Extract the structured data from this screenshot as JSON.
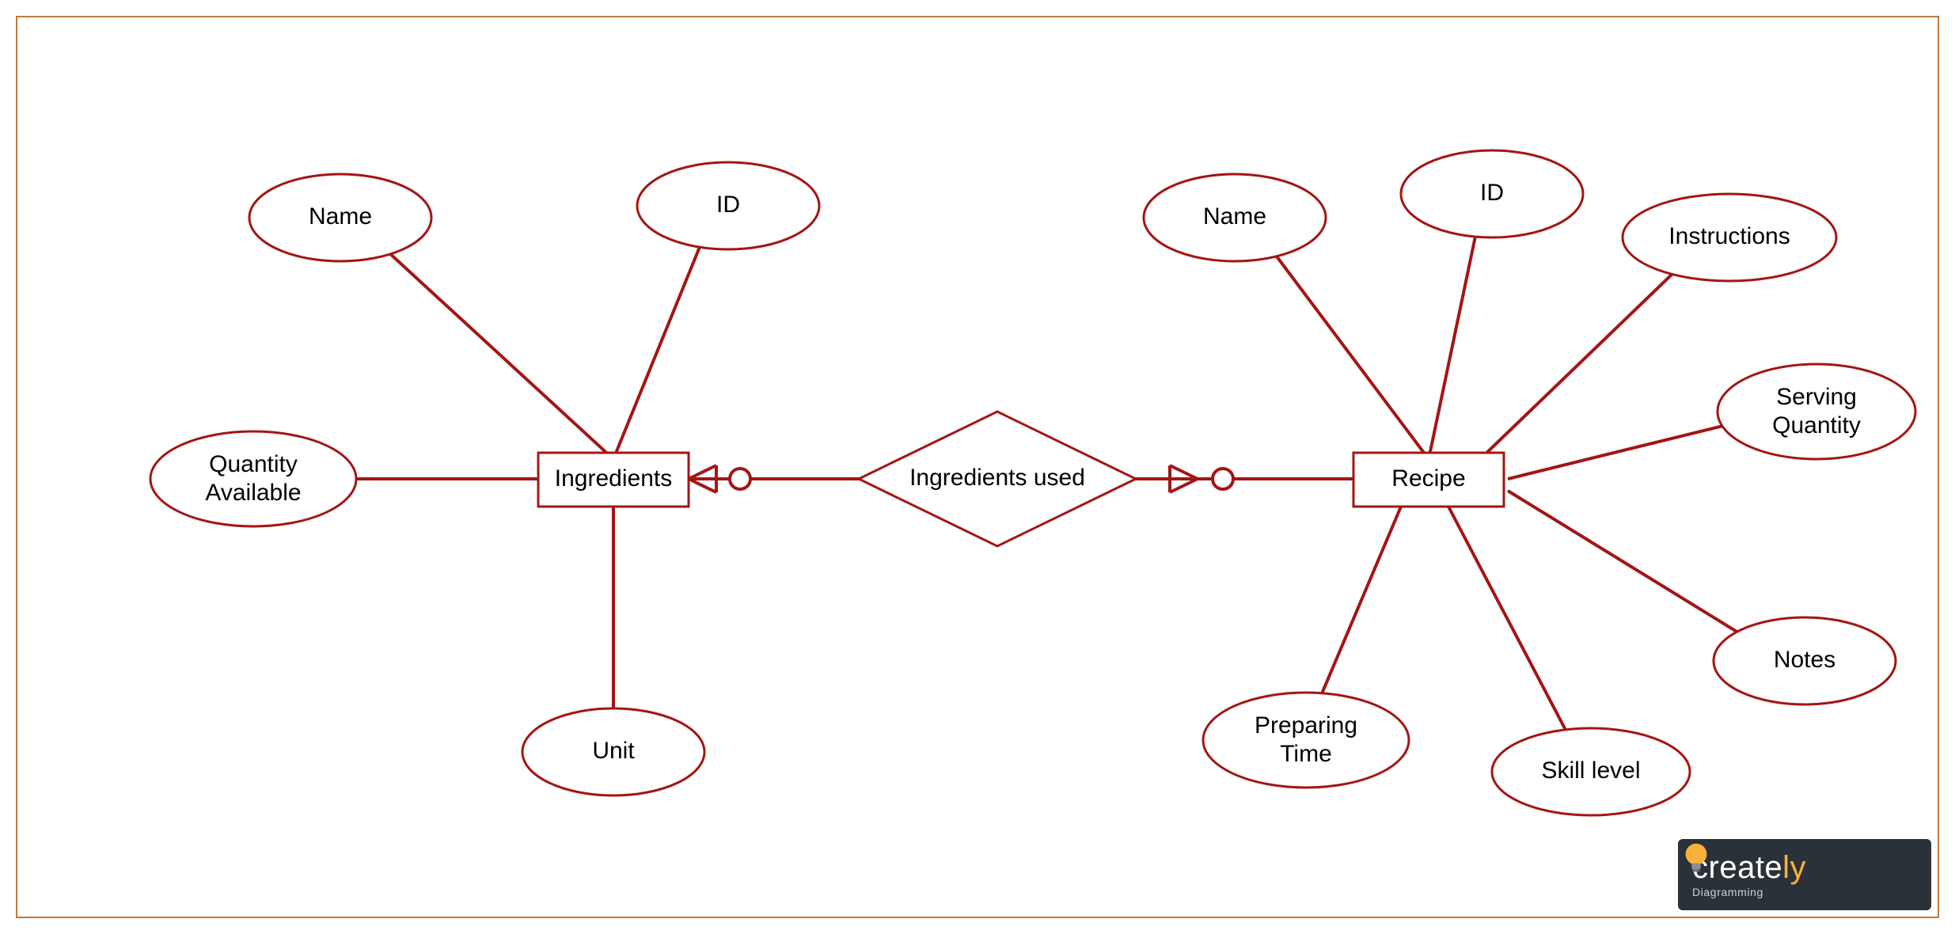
{
  "colors": {
    "stroke": "#a31515",
    "frame": "#c07a3a",
    "logo_bg": "#2b3138",
    "logo_accent": "#f6b23a"
  },
  "entities": {
    "ingredients": {
      "label": "Ingredients"
    },
    "recipe": {
      "label": "Recipe"
    }
  },
  "relationship": {
    "ingredients_used": {
      "label": "Ingredients used"
    }
  },
  "attributes": {
    "ingredients": {
      "name": {
        "label": "Name"
      },
      "id": {
        "label": "ID"
      },
      "quantity_available": {
        "label1": "Quantity",
        "label2": "Available"
      },
      "unit": {
        "label": "Unit"
      }
    },
    "recipe": {
      "name": {
        "label": "Name"
      },
      "id": {
        "label": "ID"
      },
      "instructions": {
        "label": "Instructions"
      },
      "serving_quantity": {
        "label1": "Serving",
        "label2": "Quantity"
      },
      "notes": {
        "label": "Notes"
      },
      "skill_level": {
        "label": "Skill level"
      },
      "preparing_time": {
        "label1": "Preparing",
        "label2": "Time"
      }
    }
  },
  "logo": {
    "brand_a": "create",
    "brand_b": "ly",
    "sub": "Diagramming"
  }
}
